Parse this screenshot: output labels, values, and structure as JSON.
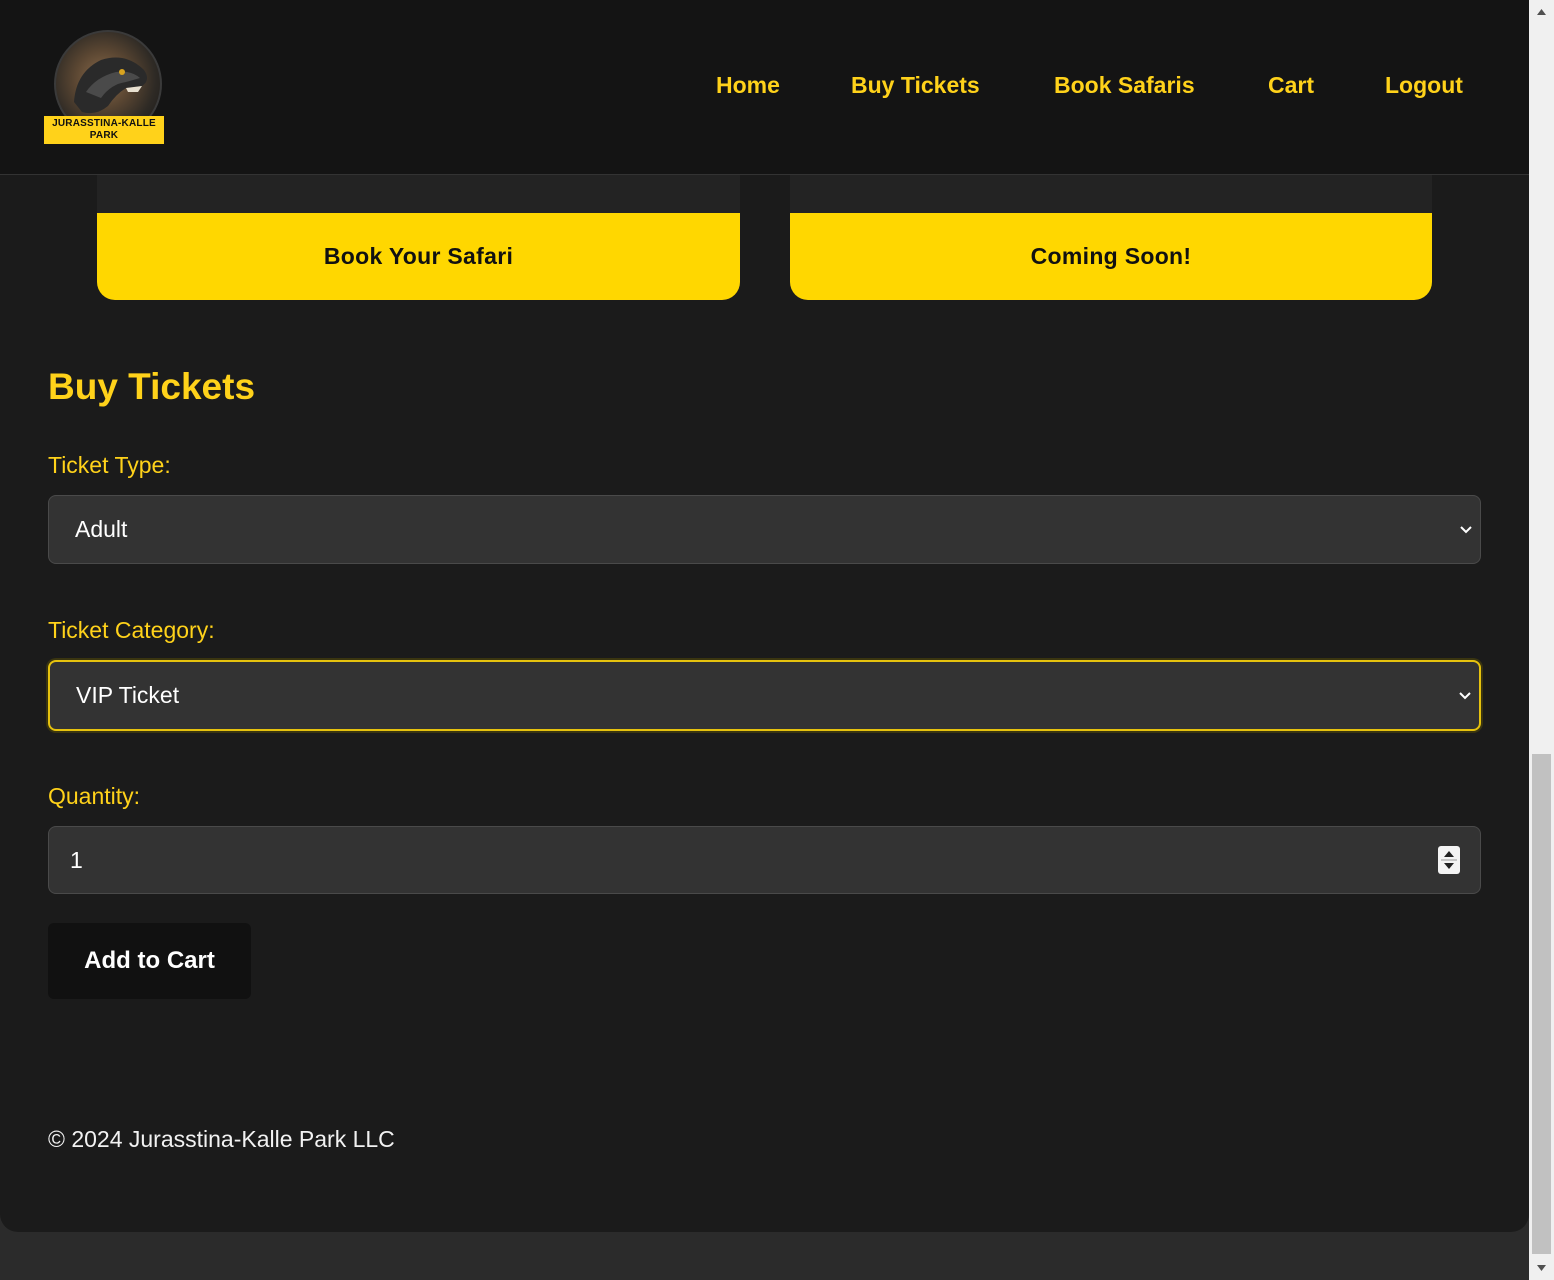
{
  "header": {
    "logo_text": "JURASSTINA-KALLE PARK",
    "nav": [
      {
        "label": "Home"
      },
      {
        "label": "Buy Tickets"
      },
      {
        "label": "Book Safaris"
      },
      {
        "label": "Cart"
      },
      {
        "label": "Logout"
      }
    ]
  },
  "cards": [
    {
      "button_label": "Book Your Safari"
    },
    {
      "button_label": "Coming Soon!"
    }
  ],
  "form": {
    "title": "Buy Tickets",
    "ticket_type": {
      "label": "Ticket Type:",
      "value": "Adult"
    },
    "ticket_category": {
      "label": "Ticket Category:",
      "value": "VIP Ticket"
    },
    "quantity": {
      "label": "Quantity:",
      "value": "1"
    },
    "submit_label": "Add to Cart"
  },
  "footer": {
    "text": "© 2024 Jurasstina-Kalle Park LLC"
  },
  "colors": {
    "accent": "#ffd700",
    "background": "#1b1b1b",
    "field": "#333333"
  },
  "icons": {
    "select_arrow": "chevron-down-icon",
    "spinner": "number-spinner-icon"
  }
}
